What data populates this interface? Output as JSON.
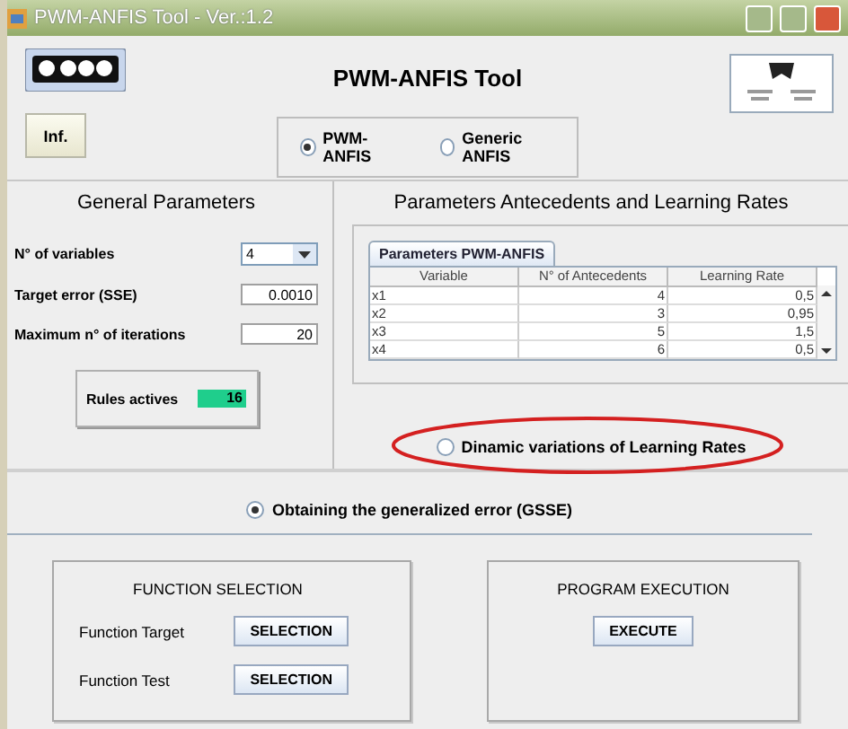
{
  "window": {
    "title": "PWM-ANFIS Tool - Ver.:1.2"
  },
  "header": {
    "title": "PWM-ANFIS Tool",
    "info_button": "Inf.",
    "modes": [
      {
        "label": "PWM-ANFIS",
        "selected": true
      },
      {
        "label": "Generic ANFIS",
        "selected": false
      }
    ]
  },
  "general_parameters": {
    "title": "General Parameters",
    "variables": {
      "label": "N° of variables",
      "value": "4"
    },
    "target_error": {
      "label": "Target error  (SSE)",
      "value": "0.0010"
    },
    "max_iterations": {
      "label": "Maximum n° of iterations",
      "value": "20"
    },
    "rules": {
      "label": "Rules actives",
      "value": "16"
    }
  },
  "antecedents": {
    "title": "Parameters Antecedents and Learning Rates",
    "tab": "Parameters PWM-ANFIS",
    "columns": [
      "Variable",
      "N° of Antecedents",
      "Learning Rate"
    ],
    "rows": [
      [
        "x1",
        "4",
        "0,5"
      ],
      [
        "x2",
        "3",
        "0,95"
      ],
      [
        "x3",
        "5",
        "1,5"
      ],
      [
        "x4",
        "6",
        "0,5"
      ]
    ],
    "dynamic_rates": {
      "label": "Dinamic variations of Learning Rates",
      "selected": false
    }
  },
  "generalized_error": {
    "label": "Obtaining the generalized error  (GSSE)",
    "selected": true
  },
  "function_selection": {
    "title": "FUNCTION SELECTION",
    "rows": [
      {
        "label": "Function Target",
        "button": "SELECTION"
      },
      {
        "label": "Function Test",
        "button": "SELECTION"
      }
    ]
  },
  "program_execution": {
    "title": "PROGRAM EXECUTION",
    "button": "EXECUTE"
  }
}
